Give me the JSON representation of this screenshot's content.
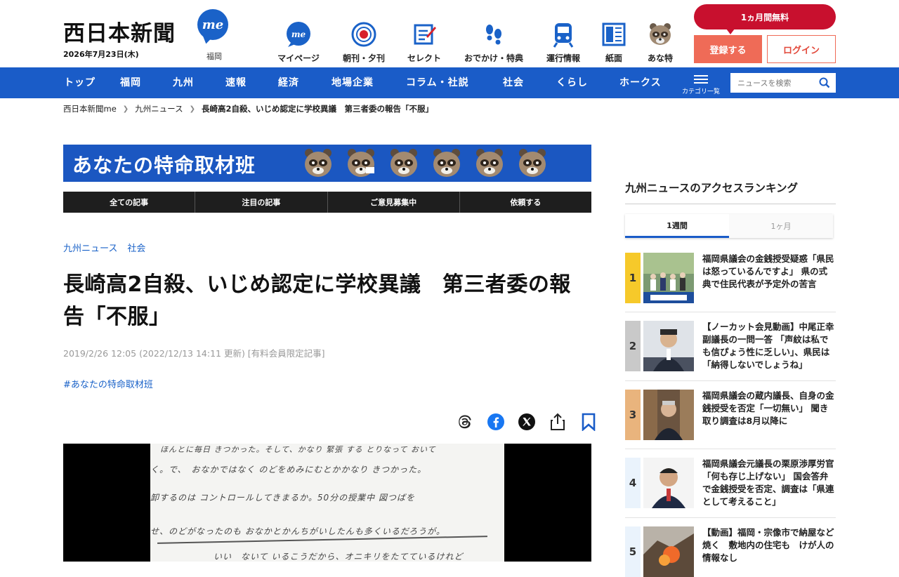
{
  "header": {
    "logo": "西日本新聞",
    "logo_badge": "me",
    "date": "2026年7月23日(木)",
    "region": "福岡",
    "nav_icons": [
      {
        "label": "マイページ",
        "icon": "me-bubble-icon"
      },
      {
        "label": "朝刊・夕刊",
        "icon": "newspaper-icon"
      },
      {
        "label": "セレクト",
        "icon": "select-icon"
      },
      {
        "label": "おでかけ・特典",
        "icon": "footprints-icon"
      },
      {
        "label": "運行情報",
        "icon": "train-icon"
      },
      {
        "label": "紙面",
        "icon": "page-icon"
      },
      {
        "label": "あな特",
        "icon": "tanuki-icon"
      }
    ],
    "trial": "1ヵ月間無料",
    "register": "登録する",
    "login": "ログイン"
  },
  "nav": {
    "items": [
      "トップ",
      "福岡",
      "九州",
      "速報",
      "経済",
      "地場企業",
      "コラム・社説",
      "社会",
      "くらし",
      "ホークス"
    ],
    "category_label": "カテゴリ一覧",
    "search_placeholder": "ニュースを検索"
  },
  "breadcrumb": [
    "西日本新聞me",
    "九州ニュース",
    "長崎高2自殺、いじめ認定に学校異議　第三者委の報告「不服」"
  ],
  "banner": {
    "title": "あなたの特命取材班",
    "tabs": [
      "全ての記事",
      "注目の記事",
      "ご意見募集中",
      "依頼する"
    ]
  },
  "article": {
    "categories": [
      "九州ニュース",
      "社会"
    ],
    "headline": "長崎高2自殺、いじめ認定に学校異議　第三者委の報告「不服」",
    "meta": "2019/2/26 12:05 (2022/12/13 14:11 更新) [有料会員限定記事]",
    "hashtag": "#あなたの特命取材班"
  },
  "sidebar": {
    "ranking_title": "九州ニュースのアクセスランキング",
    "tabs": [
      "1週間",
      "1ヶ月"
    ],
    "items": [
      {
        "rank": "1",
        "text": "福岡県議会の金銭授受疑惑「県民は怒っているんですよ」 県の式典で住民代表が予定外の苦言",
        "color": "#f6c92a"
      },
      {
        "rank": "2",
        "text": "【ノーカット会見動画】中尾正幸副議長の一問一答 「声紋は私でも信ぴょう性に乏しい」、県民は「納得しないでしょうね」",
        "color": "#c9c9c9"
      },
      {
        "rank": "3",
        "text": "福岡県議会の蔵内議長、自身の金銭授受を否定「一切無い」 聞き取り調査は8月以降に",
        "color": "#e9b47d"
      },
      {
        "rank": "4",
        "text": "福岡県議会元議長の栗原渉厚労官「何も存じ上げない」 国会答弁で金銭授受を否定、調査は「県連として考えること」",
        "color": "#eaf3fc"
      },
      {
        "rank": "5",
        "text": "【動画】福岡・宗像市で納屋など焼く　敷地内の住宅も　けが人の情報なし",
        "color": "#eaf3fc"
      }
    ]
  },
  "photo_text": [
    "ほんとに毎日 きつかった。そして、かなり 緊張 する とりなって おいて",
    "く。で、　おなかではなく のどをめみにむとかかなり きつかった。",
    "卸するのは コントロールしてきまるか。50分の授業中 図つばを",
    "せ、のどがなったのも おなかとかんちがいしたんも多くいるだろうが。",
    "いい　ないて いるこうだから、オニキリをたてているけれど"
  ]
}
